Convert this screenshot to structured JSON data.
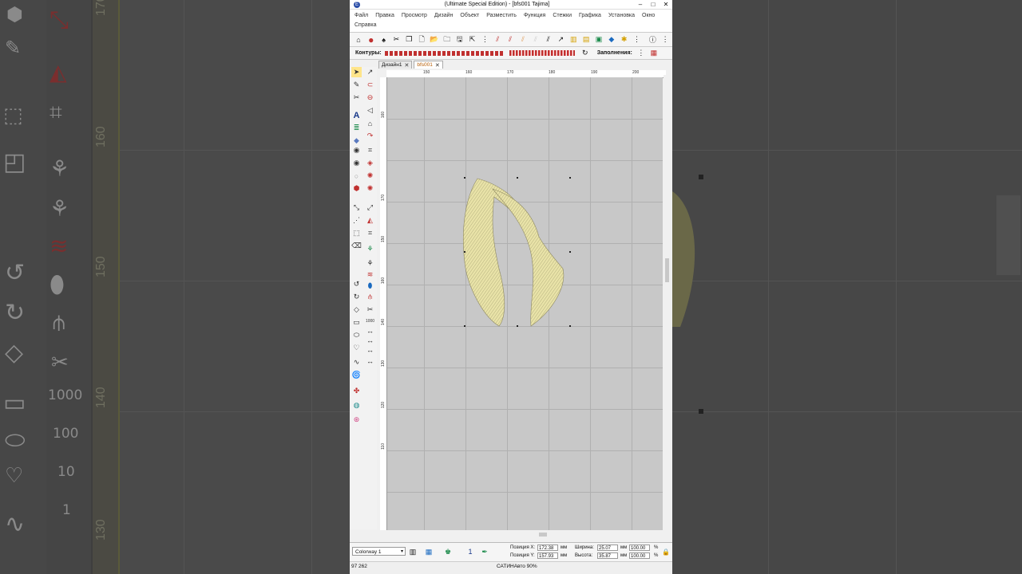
{
  "window": {
    "title": "(Ultimate Special Edition) - [bfs001     Tajima]",
    "app_icon": "E",
    "controls": [
      "–",
      "□",
      "✕"
    ]
  },
  "menu": {
    "items": [
      "Файл",
      "Правка",
      "Просмотр",
      "Дизайн",
      "Объект",
      "Разместить",
      "Функция",
      "Стежки",
      "Графика",
      "Установка",
      "Окно",
      "Справка"
    ]
  },
  "toolbar2": {
    "contours_label": "Контуры:",
    "fills_label": "Заполнения:"
  },
  "doc_tabs": [
    {
      "label": "Дизайн1",
      "close": "✕"
    },
    {
      "label": "bfs001",
      "close": "✕"
    }
  ],
  "ruler": {
    "top": [
      "150",
      "160",
      "170",
      "180",
      "190",
      "200"
    ],
    "left": [
      "160",
      "170",
      "150",
      "160",
      "140",
      "130",
      "120",
      "110"
    ]
  },
  "status": {
    "colorway": "Colorway 1",
    "needle": "1",
    "pos_x_label": "Позиция X:",
    "pos_x": "172.38",
    "pos_y_label": "Позиция Y:",
    "pos_y": "157.93",
    "unit_mm": "мм",
    "width_label": "Ширина:",
    "width": "25.07",
    "height_label": "Высота:",
    "height": "35.87",
    "scale_w": "100.00",
    "scale_h": "100.00",
    "percent": "%"
  },
  "footer": {
    "stitch_count": "97 262",
    "mode": "САТИНАвто 90%"
  },
  "background": {
    "ruler_numbers": [
      "170",
      "160",
      "150",
      "140",
      "130"
    ],
    "stitch_count_icons": [
      "1000",
      "100",
      "10",
      "1"
    ]
  },
  "colors": {
    "thread": "#e9e3a8",
    "thread_shadow": "#9c9766",
    "canvas": "#c8c8c8",
    "accent_red": "#c0302f"
  }
}
